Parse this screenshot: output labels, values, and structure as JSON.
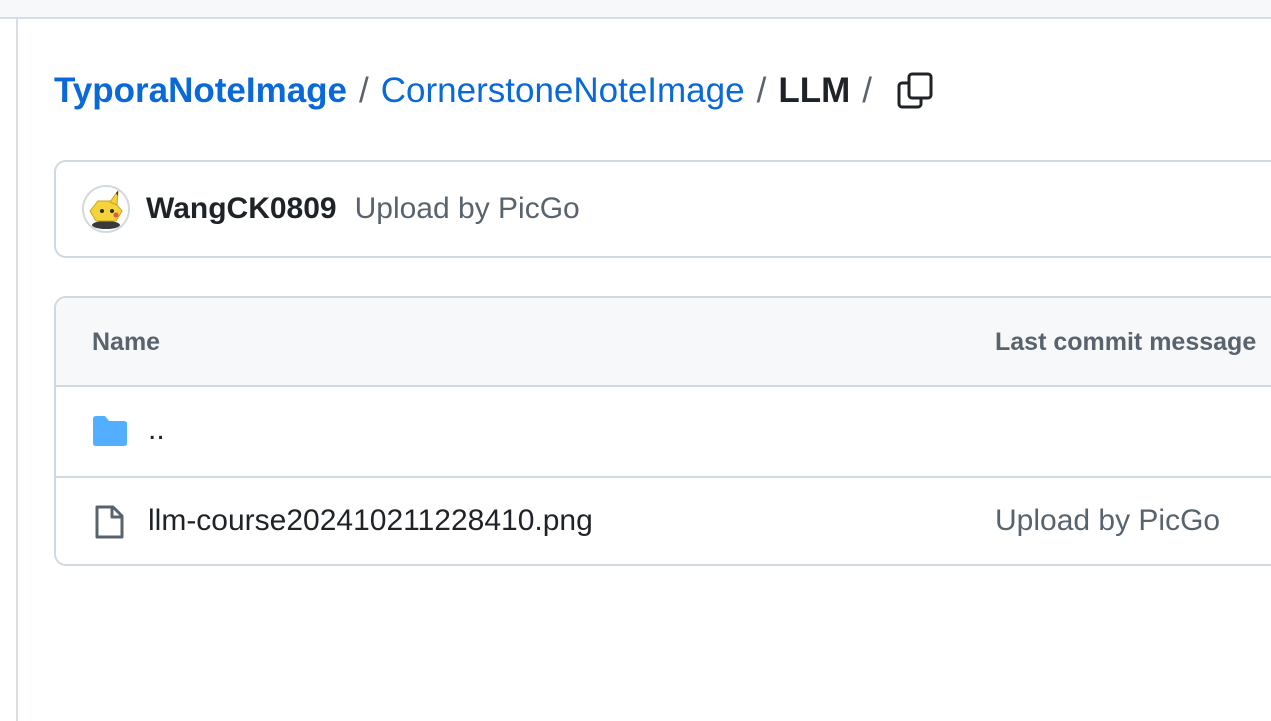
{
  "breadcrumb": {
    "root": "TyporaNoteImage",
    "folder": "CornerstoneNoteImage",
    "current": "LLM",
    "separator": "/"
  },
  "latest_commit": {
    "author": "WangCK0809",
    "message": "Upload by PicGo"
  },
  "file_table": {
    "columns": [
      "Name",
      "Last commit message"
    ],
    "rows": [
      {
        "type": "parent-directory",
        "name": "..",
        "message": ""
      },
      {
        "type": "file",
        "name": "llm-course202410211228410.png",
        "message": "Upload by PicGo"
      }
    ]
  },
  "colors": {
    "link": "#0969da",
    "folder_icon": "#54aeff",
    "muted_text": "#59636e",
    "border": "#d1d9e0",
    "header_bg": "#f6f8fa"
  }
}
